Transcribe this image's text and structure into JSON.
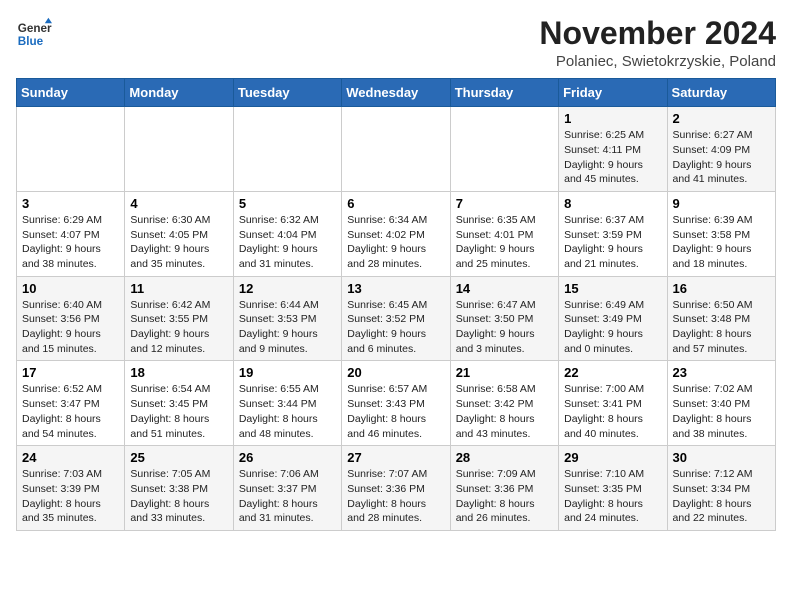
{
  "logo": {
    "general": "General",
    "blue": "Blue"
  },
  "title": "November 2024",
  "subtitle": "Polaniec, Swietokrzyskie, Poland",
  "weekdays": [
    "Sunday",
    "Monday",
    "Tuesday",
    "Wednesday",
    "Thursday",
    "Friday",
    "Saturday"
  ],
  "weeks": [
    [
      {
        "day": "",
        "info": ""
      },
      {
        "day": "",
        "info": ""
      },
      {
        "day": "",
        "info": ""
      },
      {
        "day": "",
        "info": ""
      },
      {
        "day": "",
        "info": ""
      },
      {
        "day": "1",
        "info": "Sunrise: 6:25 AM\nSunset: 4:11 PM\nDaylight: 9 hours and 45 minutes."
      },
      {
        "day": "2",
        "info": "Sunrise: 6:27 AM\nSunset: 4:09 PM\nDaylight: 9 hours and 41 minutes."
      }
    ],
    [
      {
        "day": "3",
        "info": "Sunrise: 6:29 AM\nSunset: 4:07 PM\nDaylight: 9 hours and 38 minutes."
      },
      {
        "day": "4",
        "info": "Sunrise: 6:30 AM\nSunset: 4:05 PM\nDaylight: 9 hours and 35 minutes."
      },
      {
        "day": "5",
        "info": "Sunrise: 6:32 AM\nSunset: 4:04 PM\nDaylight: 9 hours and 31 minutes."
      },
      {
        "day": "6",
        "info": "Sunrise: 6:34 AM\nSunset: 4:02 PM\nDaylight: 9 hours and 28 minutes."
      },
      {
        "day": "7",
        "info": "Sunrise: 6:35 AM\nSunset: 4:01 PM\nDaylight: 9 hours and 25 minutes."
      },
      {
        "day": "8",
        "info": "Sunrise: 6:37 AM\nSunset: 3:59 PM\nDaylight: 9 hours and 21 minutes."
      },
      {
        "day": "9",
        "info": "Sunrise: 6:39 AM\nSunset: 3:58 PM\nDaylight: 9 hours and 18 minutes."
      }
    ],
    [
      {
        "day": "10",
        "info": "Sunrise: 6:40 AM\nSunset: 3:56 PM\nDaylight: 9 hours and 15 minutes."
      },
      {
        "day": "11",
        "info": "Sunrise: 6:42 AM\nSunset: 3:55 PM\nDaylight: 9 hours and 12 minutes."
      },
      {
        "day": "12",
        "info": "Sunrise: 6:44 AM\nSunset: 3:53 PM\nDaylight: 9 hours and 9 minutes."
      },
      {
        "day": "13",
        "info": "Sunrise: 6:45 AM\nSunset: 3:52 PM\nDaylight: 9 hours and 6 minutes."
      },
      {
        "day": "14",
        "info": "Sunrise: 6:47 AM\nSunset: 3:50 PM\nDaylight: 9 hours and 3 minutes."
      },
      {
        "day": "15",
        "info": "Sunrise: 6:49 AM\nSunset: 3:49 PM\nDaylight: 9 hours and 0 minutes."
      },
      {
        "day": "16",
        "info": "Sunrise: 6:50 AM\nSunset: 3:48 PM\nDaylight: 8 hours and 57 minutes."
      }
    ],
    [
      {
        "day": "17",
        "info": "Sunrise: 6:52 AM\nSunset: 3:47 PM\nDaylight: 8 hours and 54 minutes."
      },
      {
        "day": "18",
        "info": "Sunrise: 6:54 AM\nSunset: 3:45 PM\nDaylight: 8 hours and 51 minutes."
      },
      {
        "day": "19",
        "info": "Sunrise: 6:55 AM\nSunset: 3:44 PM\nDaylight: 8 hours and 48 minutes."
      },
      {
        "day": "20",
        "info": "Sunrise: 6:57 AM\nSunset: 3:43 PM\nDaylight: 8 hours and 46 minutes."
      },
      {
        "day": "21",
        "info": "Sunrise: 6:58 AM\nSunset: 3:42 PM\nDaylight: 8 hours and 43 minutes."
      },
      {
        "day": "22",
        "info": "Sunrise: 7:00 AM\nSunset: 3:41 PM\nDaylight: 8 hours and 40 minutes."
      },
      {
        "day": "23",
        "info": "Sunrise: 7:02 AM\nSunset: 3:40 PM\nDaylight: 8 hours and 38 minutes."
      }
    ],
    [
      {
        "day": "24",
        "info": "Sunrise: 7:03 AM\nSunset: 3:39 PM\nDaylight: 8 hours and 35 minutes."
      },
      {
        "day": "25",
        "info": "Sunrise: 7:05 AM\nSunset: 3:38 PM\nDaylight: 8 hours and 33 minutes."
      },
      {
        "day": "26",
        "info": "Sunrise: 7:06 AM\nSunset: 3:37 PM\nDaylight: 8 hours and 31 minutes."
      },
      {
        "day": "27",
        "info": "Sunrise: 7:07 AM\nSunset: 3:36 PM\nDaylight: 8 hours and 28 minutes."
      },
      {
        "day": "28",
        "info": "Sunrise: 7:09 AM\nSunset: 3:36 PM\nDaylight: 8 hours and 26 minutes."
      },
      {
        "day": "29",
        "info": "Sunrise: 7:10 AM\nSunset: 3:35 PM\nDaylight: 8 hours and 24 minutes."
      },
      {
        "day": "30",
        "info": "Sunrise: 7:12 AM\nSunset: 3:34 PM\nDaylight: 8 hours and 22 minutes."
      }
    ]
  ]
}
